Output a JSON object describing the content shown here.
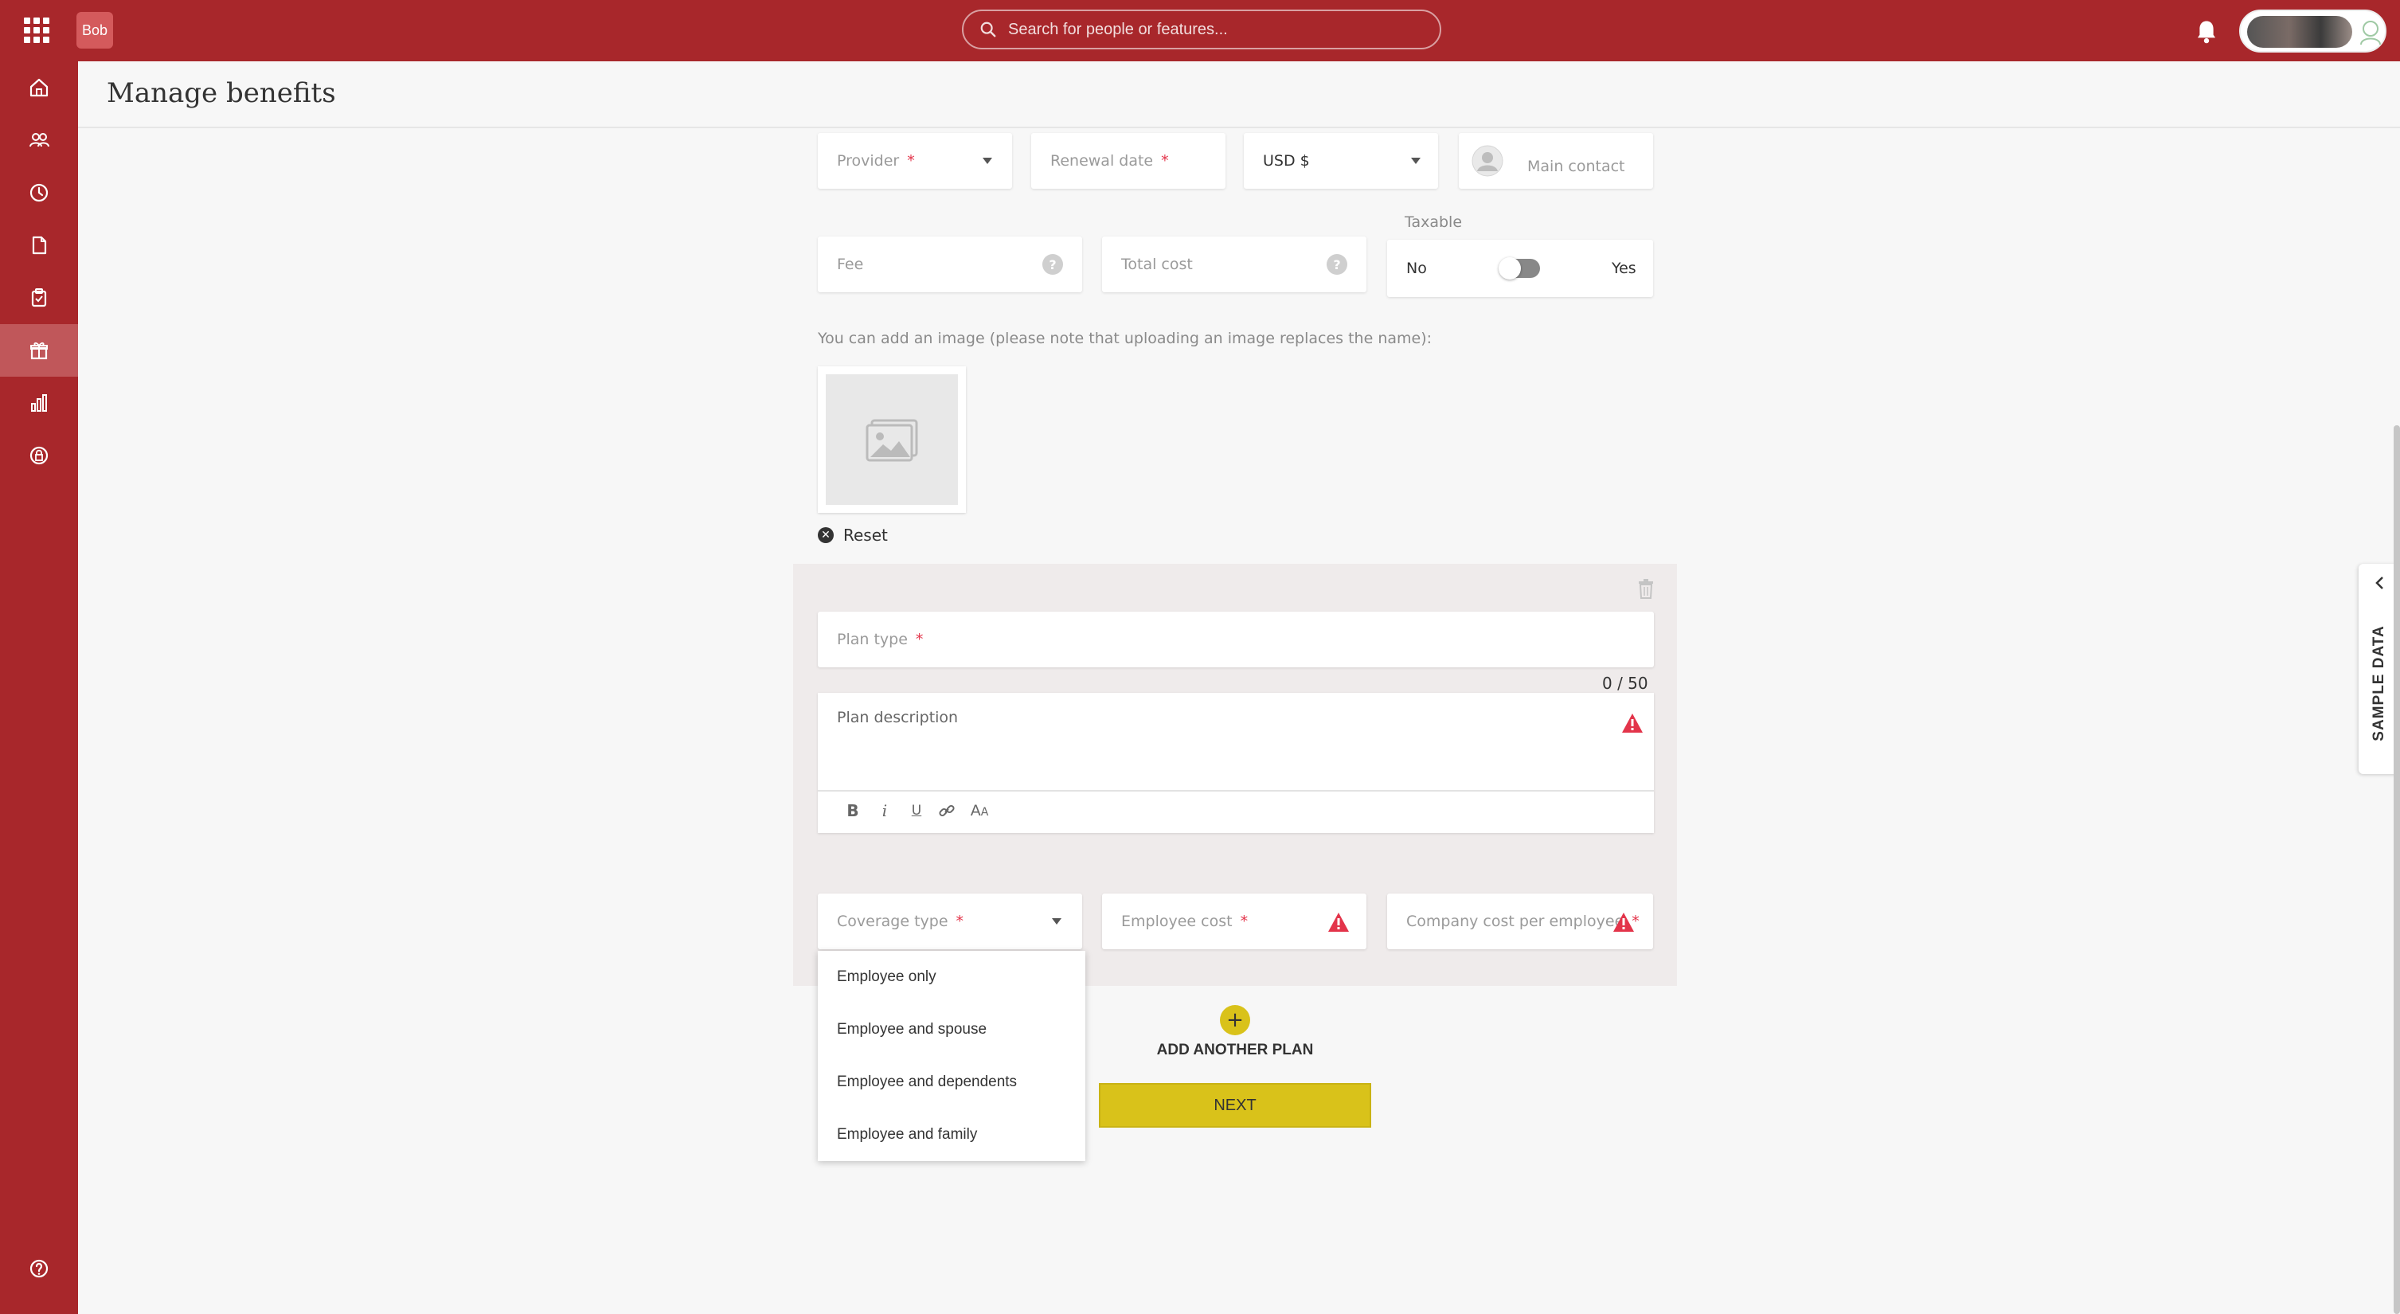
{
  "app": {
    "logo_text": "Bob"
  },
  "search": {
    "placeholder": "Search for people or features..."
  },
  "page": {
    "title": "Manage benefits"
  },
  "form": {
    "provider_label": "Provider",
    "renewal_label": "Renewal date",
    "currency_value": "USD $",
    "main_contact_label": "Main contact",
    "fee_label": "Fee",
    "total_cost_label": "Total cost",
    "taxable_label": "Taxable",
    "taxable_no": "No",
    "taxable_yes": "Yes",
    "taxable_on": false,
    "image_hint": "You can add an image (please note that uploading an image replaces the name):",
    "reset_label": "Reset",
    "required_mark": "*",
    "help_mark": "?"
  },
  "plan": {
    "plan_type_label": "Plan type",
    "char_counter": "0 / 50",
    "description_placeholder": "Plan description",
    "coverage_type_label": "Coverage type",
    "employee_cost_label": "Employee cost",
    "company_cost_label": "Company cost per employee",
    "coverage_options": [
      "Employee only",
      "Employee and spouse",
      "Employee and dependents",
      "Employee and family"
    ]
  },
  "actions": {
    "add_plan_label": "ADD ANOTHER PLAN",
    "next_label": "NEXT"
  },
  "side_tab": {
    "label": "SAMPLE DATA"
  },
  "colors": {
    "brand": "#a8272b",
    "accent": "#d9c21a",
    "warning": "#e3344a"
  }
}
